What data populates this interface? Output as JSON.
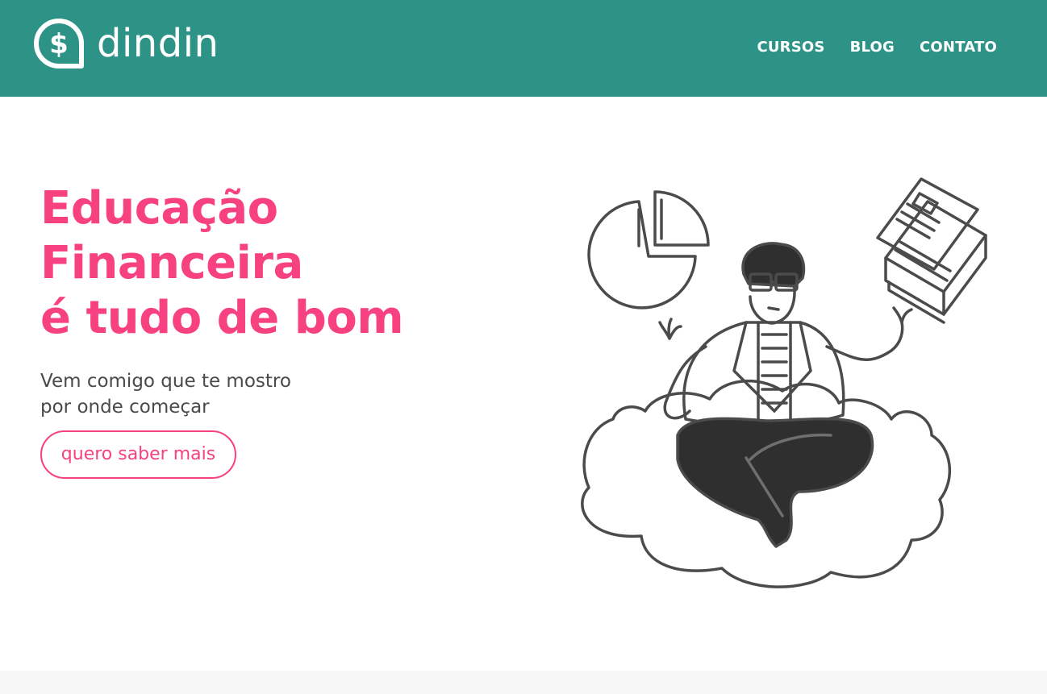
{
  "header": {
    "brand": "dindin",
    "logo_icon": "dollar-speech-bubble-icon",
    "nav": [
      {
        "label": "CURSOS"
      },
      {
        "label": "BLOG"
      },
      {
        "label": "CONTATO"
      }
    ]
  },
  "hero": {
    "title_lines": [
      "Educação",
      "Financeira",
      "é tudo de bom"
    ],
    "subtitle_lines": [
      "Vem comigo que te mostro",
      "por onde começar"
    ],
    "cta_label": "quero saber mais",
    "illustration": "person-meditating-on-cloud-illustration"
  },
  "colors": {
    "header_bg": "#2e9387",
    "accent": "#f84181",
    "text": "#4a4a4a",
    "footer_strip": "#f6f6f6"
  }
}
